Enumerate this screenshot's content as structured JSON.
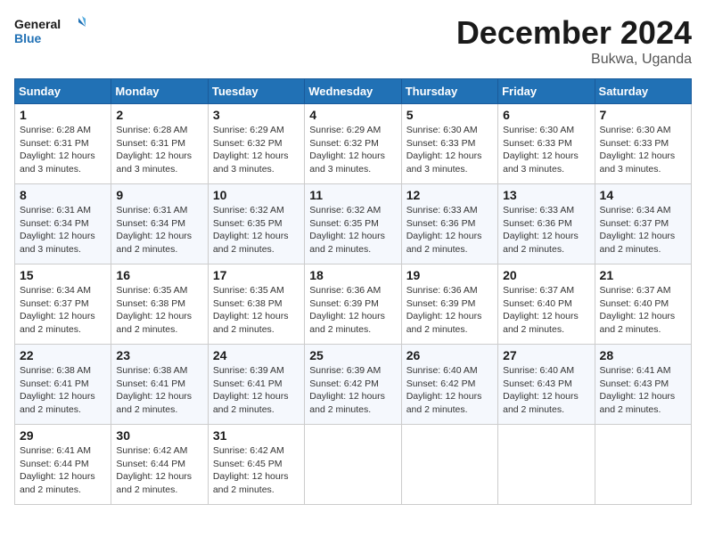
{
  "logo": {
    "line1": "General",
    "line2": "Blue"
  },
  "title": "December 2024",
  "location": "Bukwa, Uganda",
  "days_of_week": [
    "Sunday",
    "Monday",
    "Tuesday",
    "Wednesday",
    "Thursday",
    "Friday",
    "Saturday"
  ],
  "weeks": [
    [
      {
        "day": "1",
        "sunrise": "6:28 AM",
        "sunset": "6:31 PM",
        "daylight": "12 hours and 3 minutes."
      },
      {
        "day": "2",
        "sunrise": "6:28 AM",
        "sunset": "6:31 PM",
        "daylight": "12 hours and 3 minutes."
      },
      {
        "day": "3",
        "sunrise": "6:29 AM",
        "sunset": "6:32 PM",
        "daylight": "12 hours and 3 minutes."
      },
      {
        "day": "4",
        "sunrise": "6:29 AM",
        "sunset": "6:32 PM",
        "daylight": "12 hours and 3 minutes."
      },
      {
        "day": "5",
        "sunrise": "6:30 AM",
        "sunset": "6:33 PM",
        "daylight": "12 hours and 3 minutes."
      },
      {
        "day": "6",
        "sunrise": "6:30 AM",
        "sunset": "6:33 PM",
        "daylight": "12 hours and 3 minutes."
      },
      {
        "day": "7",
        "sunrise": "6:30 AM",
        "sunset": "6:33 PM",
        "daylight": "12 hours and 3 minutes."
      }
    ],
    [
      {
        "day": "8",
        "sunrise": "6:31 AM",
        "sunset": "6:34 PM",
        "daylight": "12 hours and 3 minutes."
      },
      {
        "day": "9",
        "sunrise": "6:31 AM",
        "sunset": "6:34 PM",
        "daylight": "12 hours and 2 minutes."
      },
      {
        "day": "10",
        "sunrise": "6:32 AM",
        "sunset": "6:35 PM",
        "daylight": "12 hours and 2 minutes."
      },
      {
        "day": "11",
        "sunrise": "6:32 AM",
        "sunset": "6:35 PM",
        "daylight": "12 hours and 2 minutes."
      },
      {
        "day": "12",
        "sunrise": "6:33 AM",
        "sunset": "6:36 PM",
        "daylight": "12 hours and 2 minutes."
      },
      {
        "day": "13",
        "sunrise": "6:33 AM",
        "sunset": "6:36 PM",
        "daylight": "12 hours and 2 minutes."
      },
      {
        "day": "14",
        "sunrise": "6:34 AM",
        "sunset": "6:37 PM",
        "daylight": "12 hours and 2 minutes."
      }
    ],
    [
      {
        "day": "15",
        "sunrise": "6:34 AM",
        "sunset": "6:37 PM",
        "daylight": "12 hours and 2 minutes."
      },
      {
        "day": "16",
        "sunrise": "6:35 AM",
        "sunset": "6:38 PM",
        "daylight": "12 hours and 2 minutes."
      },
      {
        "day": "17",
        "sunrise": "6:35 AM",
        "sunset": "6:38 PM",
        "daylight": "12 hours and 2 minutes."
      },
      {
        "day": "18",
        "sunrise": "6:36 AM",
        "sunset": "6:39 PM",
        "daylight": "12 hours and 2 minutes."
      },
      {
        "day": "19",
        "sunrise": "6:36 AM",
        "sunset": "6:39 PM",
        "daylight": "12 hours and 2 minutes."
      },
      {
        "day": "20",
        "sunrise": "6:37 AM",
        "sunset": "6:40 PM",
        "daylight": "12 hours and 2 minutes."
      },
      {
        "day": "21",
        "sunrise": "6:37 AM",
        "sunset": "6:40 PM",
        "daylight": "12 hours and 2 minutes."
      }
    ],
    [
      {
        "day": "22",
        "sunrise": "6:38 AM",
        "sunset": "6:41 PM",
        "daylight": "12 hours and 2 minutes."
      },
      {
        "day": "23",
        "sunrise": "6:38 AM",
        "sunset": "6:41 PM",
        "daylight": "12 hours and 2 minutes."
      },
      {
        "day": "24",
        "sunrise": "6:39 AM",
        "sunset": "6:41 PM",
        "daylight": "12 hours and 2 minutes."
      },
      {
        "day": "25",
        "sunrise": "6:39 AM",
        "sunset": "6:42 PM",
        "daylight": "12 hours and 2 minutes."
      },
      {
        "day": "26",
        "sunrise": "6:40 AM",
        "sunset": "6:42 PM",
        "daylight": "12 hours and 2 minutes."
      },
      {
        "day": "27",
        "sunrise": "6:40 AM",
        "sunset": "6:43 PM",
        "daylight": "12 hours and 2 minutes."
      },
      {
        "day": "28",
        "sunrise": "6:41 AM",
        "sunset": "6:43 PM",
        "daylight": "12 hours and 2 minutes."
      }
    ],
    [
      {
        "day": "29",
        "sunrise": "6:41 AM",
        "sunset": "6:44 PM",
        "daylight": "12 hours and 2 minutes."
      },
      {
        "day": "30",
        "sunrise": "6:42 AM",
        "sunset": "6:44 PM",
        "daylight": "12 hours and 2 minutes."
      },
      {
        "day": "31",
        "sunrise": "6:42 AM",
        "sunset": "6:45 PM",
        "daylight": "12 hours and 2 minutes."
      },
      null,
      null,
      null,
      null
    ]
  ],
  "labels": {
    "sunrise": "Sunrise:",
    "sunset": "Sunset:",
    "daylight": "Daylight:"
  }
}
